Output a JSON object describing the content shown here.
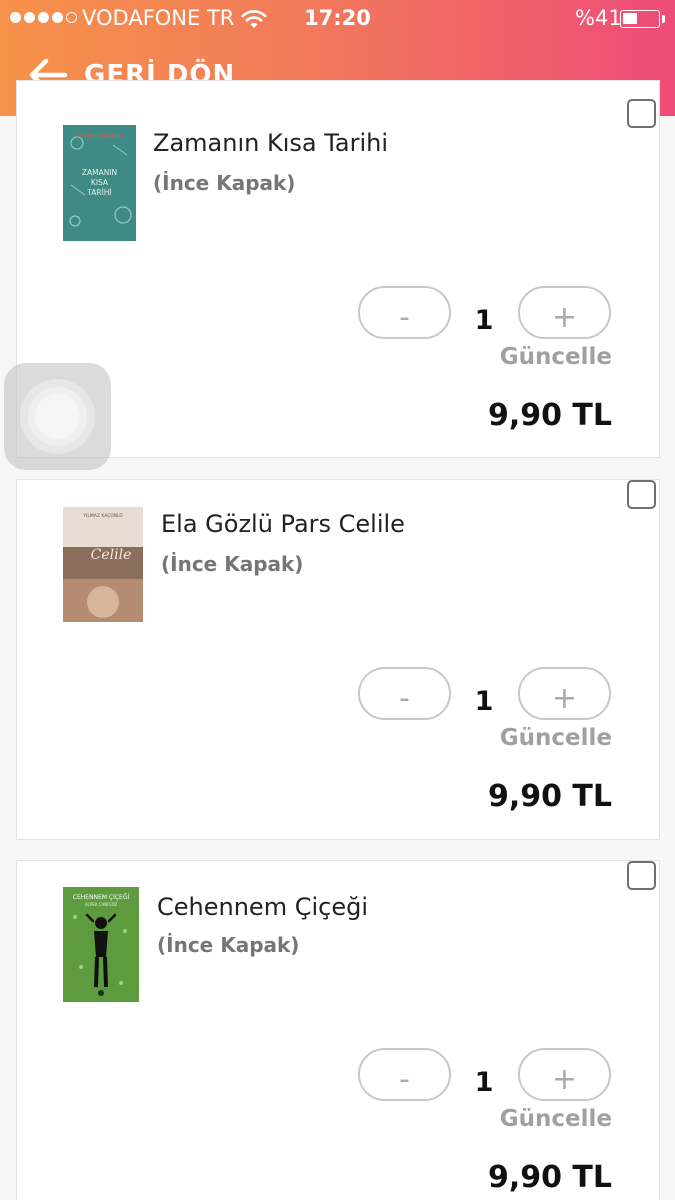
{
  "status_bar": {
    "carrier": "VODAFONE TR",
    "time": "17:20",
    "battery_percent_label": "%41",
    "battery_level": 0.41,
    "signal_bars_filled": 4,
    "signal_bars_total": 5
  },
  "header": {
    "back_label": "GERİ DÖN",
    "gradient": [
      "#f6924a",
      "#ee4c78"
    ]
  },
  "items": [
    {
      "title": "Zamanın Kısa Tarihi",
      "format": "(İnce Kapak)",
      "quantity": "1",
      "minus_label": "-",
      "plus_label": "+",
      "update_label": "Güncelle",
      "price": "9,90 TL",
      "cover_color": "#3f8a84",
      "cover_text": "ZAMANIN KISA TARİHİ",
      "cover_author": "STEPHEN HAWKING"
    },
    {
      "title": "Ela Gözlü Pars Celile",
      "format": "(İnce Kapak)",
      "quantity": "1",
      "minus_label": "-",
      "plus_label": "+",
      "update_label": "Güncelle",
      "price": "9,90 TL",
      "cover_color": "#c9a48e",
      "cover_text": "Celile",
      "cover_author": "YILMAZ KAÇÜNLÜ"
    },
    {
      "title": "Cehennem Çiçeği",
      "format": "(İnce Kapak)",
      "quantity": "1",
      "minus_label": "-",
      "plus_label": "+",
      "update_label": "Güncelle",
      "price": "9,90 TL",
      "cover_color": "#5d9b3e",
      "cover_text": "CEHENNEM ÇİÇEĞİ",
      "cover_author": "ALPER CANİGÜZ"
    }
  ]
}
